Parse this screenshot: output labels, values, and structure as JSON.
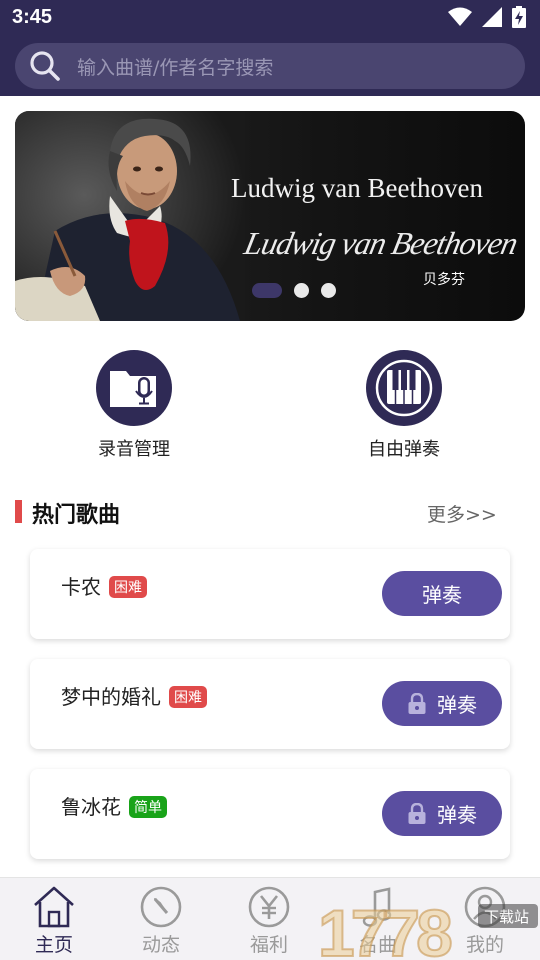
{
  "status_bar": {
    "time": "3:45",
    "icons": [
      "wifi-icon",
      "signal-icon",
      "battery-charging-icon"
    ]
  },
  "search": {
    "placeholder": "输入曲谱/作者名字搜索",
    "icon": "search-icon"
  },
  "banner": {
    "title": "Ludwig van Beethoven",
    "signature": "Ludwig van Beethoven",
    "subtitle": "贝多芬",
    "slides": 3,
    "active_slide": 1
  },
  "quick_actions": [
    {
      "label": "录音管理",
      "icon": "folder-mic-icon"
    },
    {
      "label": "自由弹奏",
      "icon": "piano-keys-icon"
    }
  ],
  "hot_songs": {
    "title": "热门歌曲",
    "more": "更多>>",
    "items": [
      {
        "name": "卡农",
        "difficulty": "困难",
        "level": "hard",
        "locked": false,
        "action": "弹奏"
      },
      {
        "name": "梦中的婚礼",
        "difficulty": "困难",
        "level": "hard",
        "locked": true,
        "action": "弹奏"
      },
      {
        "name": "鲁冰花",
        "difficulty": "简单",
        "level": "easy",
        "locked": true,
        "action": "弹奏"
      }
    ]
  },
  "bottom_nav": [
    {
      "label": "主页",
      "icon": "home-icon",
      "active": true
    },
    {
      "label": "动态",
      "icon": "compass-icon",
      "active": false
    },
    {
      "label": "福利",
      "icon": "yen-icon",
      "active": false
    },
    {
      "label": "名曲",
      "icon": "music-note-icon",
      "active": false
    },
    {
      "label": "我的",
      "icon": "profile-icon",
      "active": false
    }
  ],
  "watermark": {
    "text": "1778",
    "caption": "下载站"
  },
  "colors": {
    "primary": "#2f2a55",
    "button": "#5a4ea0",
    "hard_badge": "#e04a4a",
    "easy_badge": "#19a319",
    "section_accent": "#e04a4a"
  }
}
